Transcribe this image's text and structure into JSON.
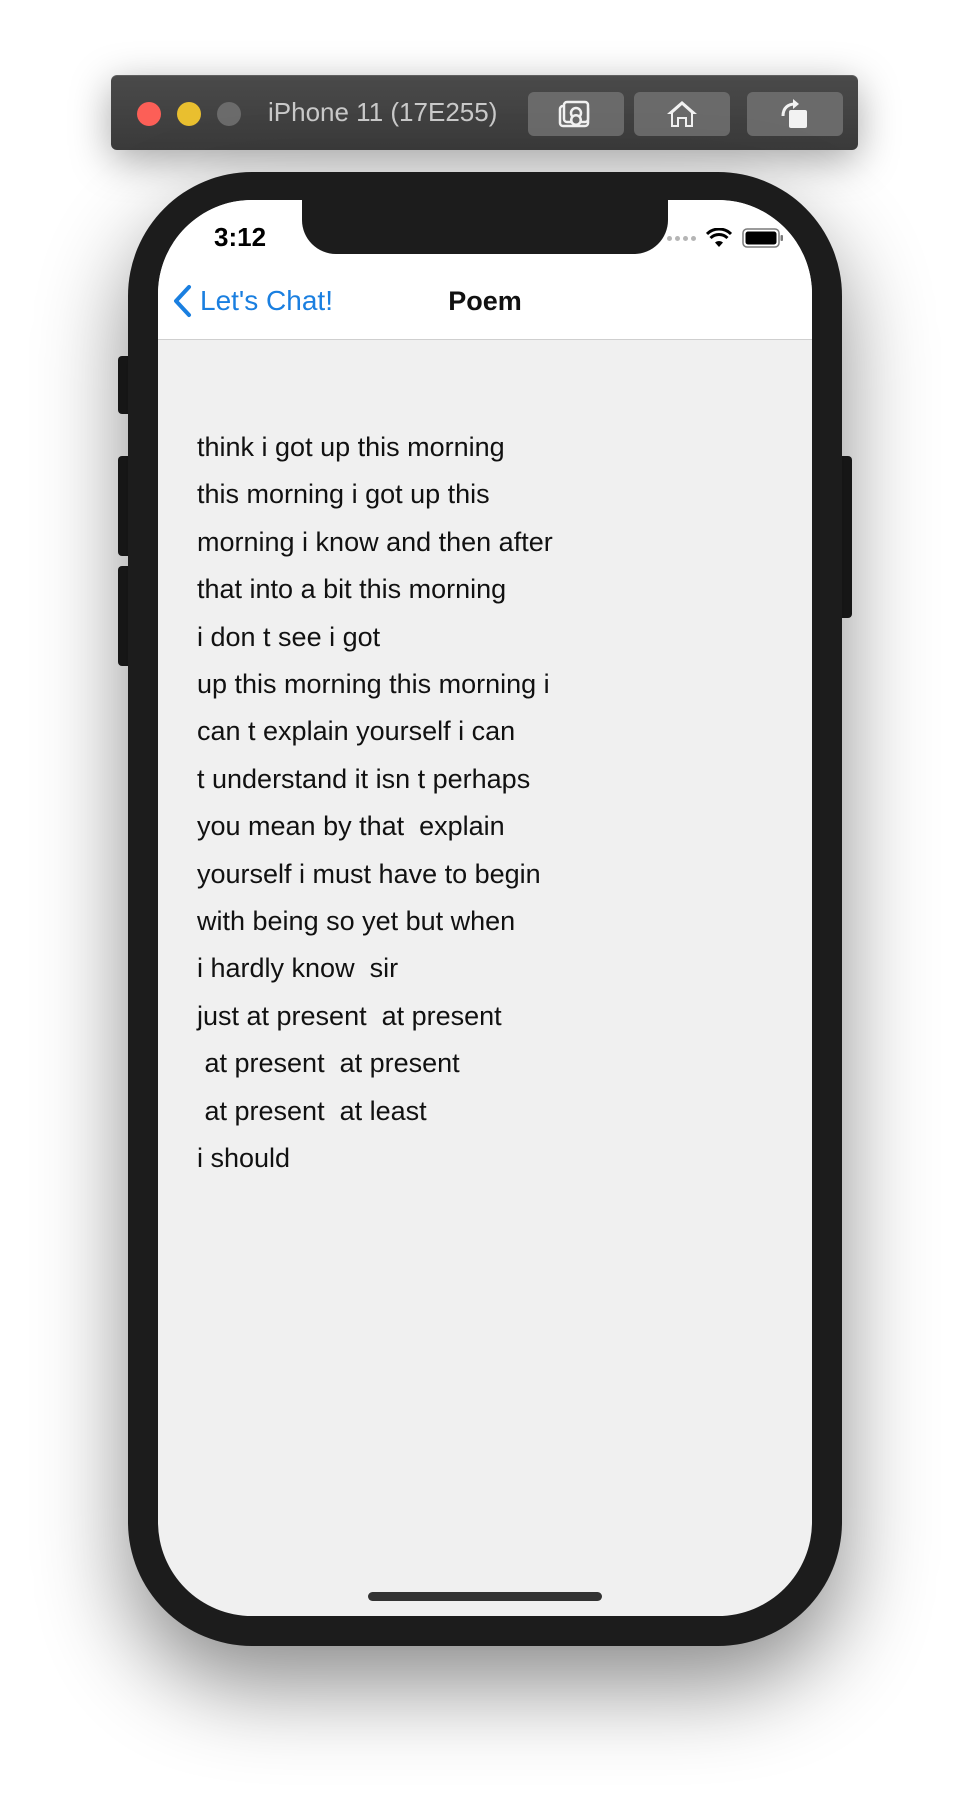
{
  "simulator": {
    "title": "iPhone 11 (17E255)",
    "buttons": [
      "screenshot-icon",
      "home-icon",
      "rotate-icon"
    ]
  },
  "status_bar": {
    "time": "3:12"
  },
  "nav": {
    "back_label": "Let's Chat!",
    "title": "Poem"
  },
  "poem": {
    "lines": [
      "think i got up this morning",
      "this morning i got up this",
      "morning i know and then after",
      "that into a bit this morning",
      "i don t see i got",
      "up this morning this morning i",
      "can t explain yourself i can",
      "t understand it isn t perhaps",
      "you mean by that  explain",
      "yourself i must have to begin",
      "with being so yet but when",
      "i hardly know  sir",
      "just at present  at present",
      " at present  at present",
      " at present  at least",
      "i should"
    ]
  },
  "colors": {
    "accent": "#1a7fe0",
    "background": "#f0f0f0"
  }
}
